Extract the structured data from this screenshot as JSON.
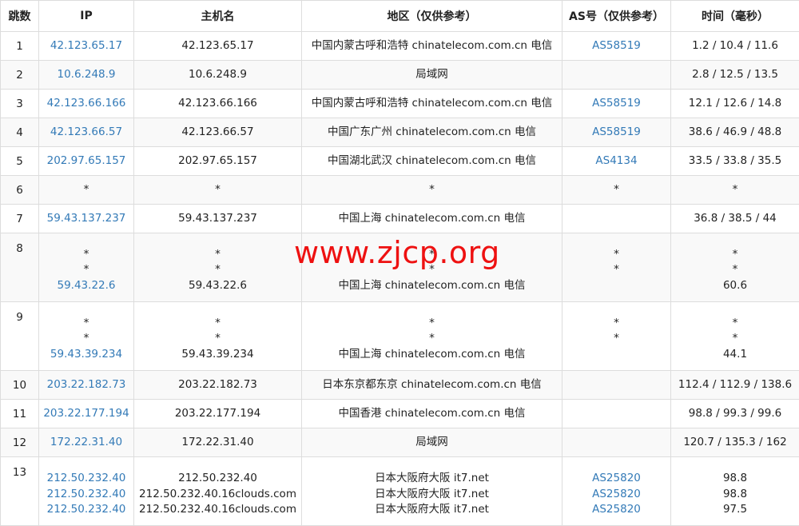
{
  "headers": [
    "跳数",
    "IP",
    "主机名",
    "地区（仅供参考）",
    "AS号（仅供参考）",
    "时间（毫秒）"
  ],
  "watermark": "www.zjcp.org",
  "rows": [
    {
      "hop": "1",
      "ips": [
        "42.123.65.17"
      ],
      "hosts": [
        "42.123.65.17"
      ],
      "regions": [
        "中国内蒙古呼和浩特 chinatelecom.com.cn 电信"
      ],
      "as": [
        "AS58519"
      ],
      "times": [
        "1.2 / 10.4 / 11.6"
      ]
    },
    {
      "hop": "2",
      "ips": [
        "10.6.248.9"
      ],
      "hosts": [
        "10.6.248.9"
      ],
      "regions": [
        "局域网"
      ],
      "as": [
        ""
      ],
      "times": [
        "2.8 / 12.5 / 13.5"
      ]
    },
    {
      "hop": "3",
      "ips": [
        "42.123.66.166"
      ],
      "hosts": [
        "42.123.66.166"
      ],
      "regions": [
        "中国内蒙古呼和浩特 chinatelecom.com.cn 电信"
      ],
      "as": [
        "AS58519"
      ],
      "times": [
        "12.1 / 12.6 / 14.8"
      ]
    },
    {
      "hop": "4",
      "ips": [
        "42.123.66.57"
      ],
      "hosts": [
        "42.123.66.57"
      ],
      "regions": [
        "中国广东广州 chinatelecom.com.cn 电信"
      ],
      "as": [
        "AS58519"
      ],
      "times": [
        "38.6 / 46.9 / 48.8"
      ]
    },
    {
      "hop": "5",
      "ips": [
        "202.97.65.157"
      ],
      "hosts": [
        "202.97.65.157"
      ],
      "regions": [
        "中国湖北武汉 chinatelecom.com.cn 电信"
      ],
      "as": [
        "AS4134"
      ],
      "times": [
        "33.5 / 33.8 / 35.5"
      ]
    },
    {
      "hop": "6",
      "ips": [
        "*"
      ],
      "hosts": [
        "*"
      ],
      "regions": [
        "*"
      ],
      "as": [
        "*"
      ],
      "times": [
        "*"
      ]
    },
    {
      "hop": "7",
      "ips": [
        "59.43.137.237"
      ],
      "hosts": [
        "59.43.137.237"
      ],
      "regions": [
        "中国上海 chinatelecom.com.cn 电信"
      ],
      "as": [
        ""
      ],
      "times": [
        "36.8 / 38.5 / 44"
      ]
    },
    {
      "hop": "8",
      "ips": [
        "*",
        "*",
        "59.43.22.6"
      ],
      "hosts": [
        "*",
        "*",
        "59.43.22.6"
      ],
      "regions": [
        "*",
        "*",
        "中国上海 chinatelecom.com.cn 电信"
      ],
      "as": [
        "*",
        "*",
        ""
      ],
      "times": [
        "*",
        "*",
        "60.6"
      ]
    },
    {
      "hop": "9",
      "ips": [
        "*",
        "*",
        "59.43.39.234"
      ],
      "hosts": [
        "*",
        "*",
        "59.43.39.234"
      ],
      "regions": [
        "*",
        "*",
        "中国上海 chinatelecom.com.cn 电信"
      ],
      "as": [
        "*",
        "*",
        ""
      ],
      "times": [
        "*",
        "*",
        "44.1"
      ]
    },
    {
      "hop": "10",
      "ips": [
        "203.22.182.73"
      ],
      "hosts": [
        "203.22.182.73"
      ],
      "regions": [
        "日本东京都东京 chinatelecom.com.cn 电信"
      ],
      "as": [
        ""
      ],
      "times": [
        "112.4 / 112.9 / 138.6"
      ]
    },
    {
      "hop": "11",
      "ips": [
        "203.22.177.194"
      ],
      "hosts": [
        "203.22.177.194"
      ],
      "regions": [
        "中国香港 chinatelecom.com.cn 电信"
      ],
      "as": [
        ""
      ],
      "times": [
        "98.8 / 99.3 / 99.6"
      ]
    },
    {
      "hop": "12",
      "ips": [
        "172.22.31.40"
      ],
      "hosts": [
        "172.22.31.40"
      ],
      "regions": [
        "局域网"
      ],
      "as": [
        ""
      ],
      "times": [
        "120.7 / 135.3 / 162"
      ]
    },
    {
      "hop": "13",
      "ips": [
        "212.50.232.40",
        "212.50.232.40",
        "212.50.232.40"
      ],
      "hosts": [
        "212.50.232.40",
        "212.50.232.40.16clouds.com",
        "212.50.232.40.16clouds.com"
      ],
      "regions": [
        "日本大阪府大阪 it7.net",
        "日本大阪府大阪 it7.net",
        "日本大阪府大阪 it7.net"
      ],
      "as": [
        "AS25820",
        "AS25820",
        "AS25820"
      ],
      "times": [
        "98.8",
        "98.8",
        "97.5"
      ]
    }
  ],
  "colors": {
    "link": "#337ab7",
    "watermark": "#ee1111",
    "border": "#dddddd",
    "alt_row": "#f9f9f9"
  }
}
